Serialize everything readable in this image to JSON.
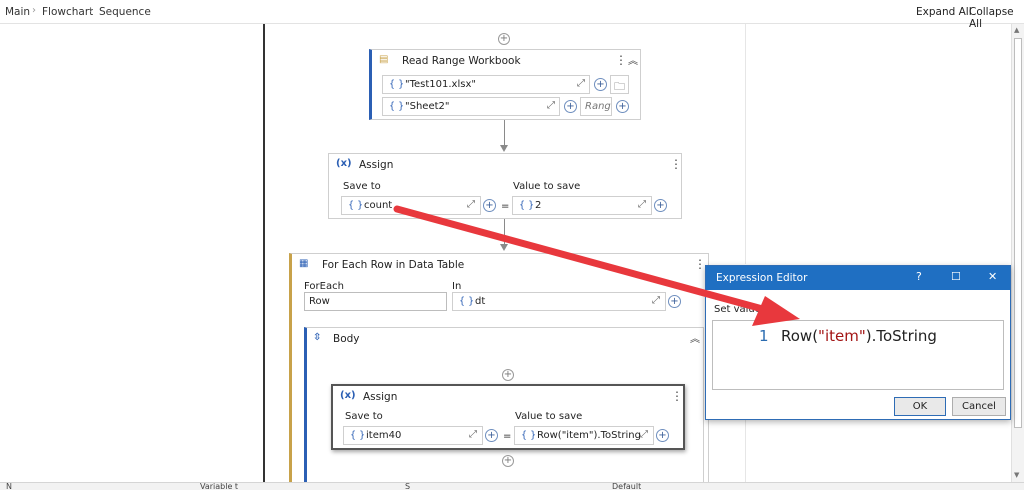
{
  "breadcrumb": {
    "items": [
      "Main",
      "Flowchart",
      "Sequence"
    ]
  },
  "toolbar": {
    "expand_all": "Expand All",
    "collapse_all": "Collapse All"
  },
  "read_range": {
    "title": "Read Range Workbook",
    "workbook_path": "\"Test101.xlsx\"",
    "sheet_name": "\"Sheet2\"",
    "range_placeholder": "Rang"
  },
  "assign_top": {
    "title": "Assign",
    "save_to_label": "Save to",
    "value_label": "Value to save",
    "save_to": "count",
    "value": "2",
    "equals": "="
  },
  "for_each": {
    "title": "For Each Row in Data Table",
    "foreach_label": "ForEach",
    "foreach_value": "Row",
    "in_label": "In",
    "in_value": "dt",
    "body_title": "Body"
  },
  "assign_inner": {
    "title": "Assign",
    "save_to_label": "Save to",
    "value_label": "Value to save",
    "save_to": "item40",
    "value": "Row(\"item\").ToString",
    "equals": "="
  },
  "expression_editor": {
    "title": "Expression Editor",
    "help": "?",
    "maximize": "☐",
    "close": "✕",
    "subtitle": "Set value (S",
    "line_number": "1",
    "code_pre": "Row(",
    "code_str": "\"item\"",
    "code_post": ").ToString",
    "ok": "OK",
    "cancel": "Cancel"
  },
  "icons": {
    "brace": "{ }",
    "plus": "+",
    "expand": "⤢",
    "kebab": "⋮",
    "collapse": "︽",
    "assign_icon": "(x)"
  },
  "colors": {
    "accent": "#1f6fc2",
    "annotation_arrow": "#e8383d",
    "foreach_bar": "#c8a24a"
  },
  "bottom_panel": {
    "col1": "N",
    "col2": "Variable t",
    "col3": "S",
    "col4": "Default"
  }
}
